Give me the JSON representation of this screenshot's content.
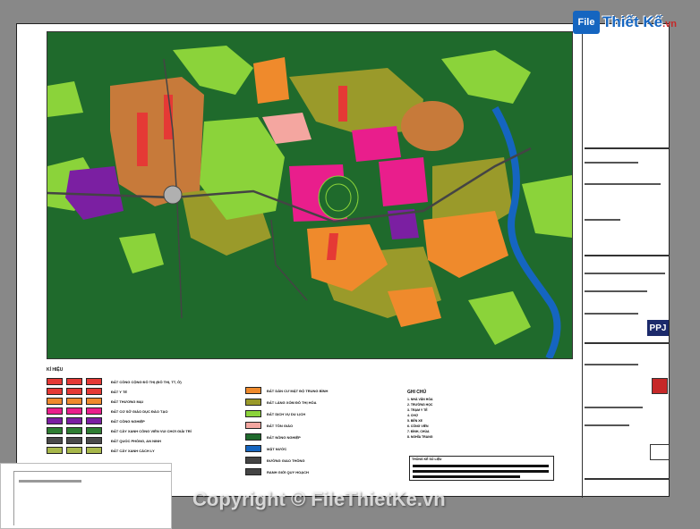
{
  "watermark": {
    "logo_mark": "File",
    "logo_text": "Thiết Kế",
    "logo_domain": ".vn",
    "copyright": "Copyright © FileThietKe.vn"
  },
  "title_block": {
    "ppj": "PPJ"
  },
  "legend": {
    "title": "KÍ HIỆU",
    "left_items": [
      {
        "label": "ĐẤT CÔNG CỘNG ĐÔ THỊ (ĐÔ THỊ, TT, Ở)",
        "colors": [
          "#e53935",
          "#e53935",
          "#e53935"
        ]
      },
      {
        "label": "ĐẤT Y TẾ",
        "colors": [
          "#e53935",
          "#e53935",
          "#e53935"
        ]
      },
      {
        "label": "ĐẤT THƯƠNG MẠI",
        "colors": [
          "#ef8a2c",
          "#ef8a2c",
          "#ef8a2c"
        ]
      },
      {
        "label": "ĐẤT CƠ SỞ GIÁO DỤC ĐÀO TẠO",
        "colors": [
          "#e91e8c",
          "#e91e8c",
          "#e91e8c"
        ]
      },
      {
        "label": "ĐẤT CÔNG NGHIỆP",
        "colors": [
          "#7b1fa2",
          "#7b1fa2",
          "#7b1fa2"
        ]
      },
      {
        "label": "ĐẤT CÂY XANH CÔNG VIÊN VUI CHƠI GIẢI TRÍ",
        "colors": [
          "#2e7d32",
          "#2e7d32",
          "#2e7d32"
        ]
      },
      {
        "label": "ĐẤT QUỐC PHÒNG, AN NINH",
        "colors": [
          "#4a4a4a",
          "#4a4a4a",
          "#4a4a4a"
        ]
      },
      {
        "label": "ĐẤT CÂY XANH CÁCH LY",
        "colors": [
          "#a7b74a",
          "#a7b74a",
          "#a7b74a"
        ]
      }
    ],
    "mid_items": [
      {
        "label": "ĐẤT DÂN CƯ MẬT ĐỘ TRUNG BÌNH",
        "color": "#ef8a2c"
      },
      {
        "label": "ĐẤT LÀNG XÓM ĐÔ THỊ HÓA",
        "color": "#9a9a2a"
      },
      {
        "label": "ĐẤT DỊCH VỤ DU LỊCH",
        "color": "#8bd33a"
      },
      {
        "label": "ĐẤT TÔN GIÁO",
        "color": "#f4a6a0"
      },
      {
        "label": "ĐẤT NÔNG NGHIỆP",
        "color": "#1f6a2c"
      },
      {
        "label": "MẶT NƯỚC",
        "color": "#1565c0"
      },
      {
        "label": "ĐƯỜNG GIAO THÔNG",
        "color": "#444444"
      },
      {
        "label": "RANH GIỚI QUY HOẠCH",
        "color": "#444444"
      }
    ],
    "notes_title": "GHI CHÚ",
    "notes": [
      "1. NHÀ VĂN HÓA",
      "2. TRƯỜNG HỌC",
      "3. TRẠM Y TẾ",
      "4. CHỢ",
      "5. BẾN XE",
      "6. CÔNG VIÊN",
      "7. ĐÌNH, CHÙA",
      "8. NGHĨA TRANG"
    ],
    "notebox_title": "THỐNG KÊ SỐ LIỆU"
  }
}
